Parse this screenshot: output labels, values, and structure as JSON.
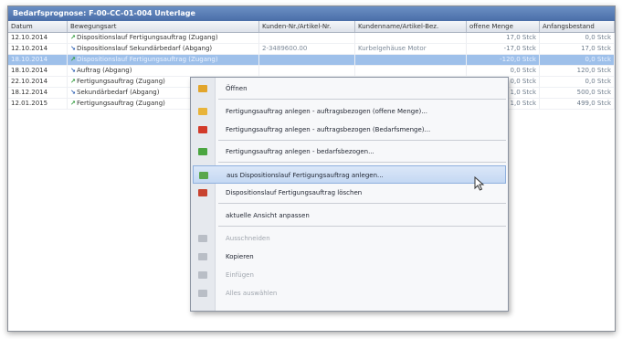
{
  "window": {
    "title": "Bedarfsprognose: F-00-CC-01-004 Unterlage"
  },
  "table": {
    "columns": [
      "Datum",
      "Bewegungsart",
      "Kunden-Nr./Artikel-Nr.",
      "Kundenname/Artikel-Bez.",
      "offene Menge",
      "Anfangsbestand"
    ],
    "rows": [
      {
        "date": "12.10.2014",
        "dir": "in",
        "type": "Dispositionslauf Fertigungsauftrag (Zugang)",
        "kunde": "",
        "name": "",
        "menge": "17,0 Stck",
        "bestand": "0,0 Stck",
        "selected": false
      },
      {
        "date": "12.10.2014",
        "dir": "out",
        "type": "Dispositionslauf Sekundärbedarf (Abgang)",
        "kunde": "2-3489600.00",
        "name": "Kurbelgehäuse Motor",
        "menge": "-17,0 Stck",
        "bestand": "17,0 Stck",
        "selected": false
      },
      {
        "date": "18.10.2014",
        "dir": "in",
        "type": "Dispositionslauf Fertigungsauftrag (Zugang)",
        "kunde": "",
        "name": "",
        "menge": "-120,0 Stck",
        "bestand": "0,0 Stck",
        "selected": true
      },
      {
        "date": "18.10.2014",
        "dir": "out",
        "type": "Auftrag (Abgang)",
        "kunde": "",
        "name": "",
        "menge": "0,0 Stck",
        "bestand": "120,0 Stck",
        "selected": false
      },
      {
        "date": "22.10.2014",
        "dir": "in",
        "type": "Fertigungsauftrag (Zugang)",
        "kunde": "",
        "name": "",
        "menge": "0,0 Stck",
        "bestand": "0,0 Stck",
        "selected": false
      },
      {
        "date": "18.12.2014",
        "dir": "out",
        "type": "Sekundärbedarf (Abgang)",
        "kunde": "",
        "name": "",
        "menge": "1,0 Stck",
        "bestand": "500,0 Stck",
        "selected": false
      },
      {
        "date": "12.01.2015",
        "dir": "in",
        "type": "Fertigungsauftrag (Zugang)",
        "kunde": "",
        "name": "",
        "menge": "1,0 Stck",
        "bestand": "499,0 Stck",
        "selected": false
      }
    ]
  },
  "context_menu": {
    "items": [
      {
        "label": "Öffnen",
        "icon_color": "#e2a52b",
        "disabled": false,
        "hover": false
      },
      {
        "label": "Fertigungsauftrag anlegen - auftragsbezogen (offene Menge)...",
        "icon_color": "#e8b43a",
        "disabled": false,
        "hover": false
      },
      {
        "label": "Fertigungsauftrag anlegen - auftragsbezogen (Bedarfsmenge)...",
        "icon_color": "#d23a2a",
        "disabled": false,
        "hover": false
      },
      {
        "label": "Fertigungsauftrag anlegen - bedarfsbezogen...",
        "icon_color": "#4aa540",
        "disabled": false,
        "hover": false
      },
      {
        "label": "aus Dispositionslauf Fertigungsauftrag anlegen...",
        "icon_color": "#5aa74d",
        "disabled": false,
        "hover": true
      },
      {
        "label": "Dispositionslauf Fertigungsauftrag löschen",
        "icon_color": "#c8432f",
        "disabled": false,
        "hover": false
      },
      {
        "label": "aktuelle Ansicht anpassen",
        "icon_color": "",
        "disabled": false,
        "hover": false
      },
      {
        "label": "Ausschneiden",
        "icon_color": "#b9bec6",
        "disabled": true,
        "hover": false
      },
      {
        "label": "Kopieren",
        "icon_color": "#b9bec6",
        "disabled": false,
        "hover": false
      },
      {
        "label": "Einfügen",
        "icon_color": "#b9bec6",
        "disabled": true,
        "hover": false
      },
      {
        "label": "Alles auswählen",
        "icon_color": "#b9bec6",
        "disabled": true,
        "hover": false
      }
    ]
  },
  "icons": {
    "in_arrow": "arrow-up-right-icon",
    "out_arrow": "arrow-down-right-icon"
  }
}
